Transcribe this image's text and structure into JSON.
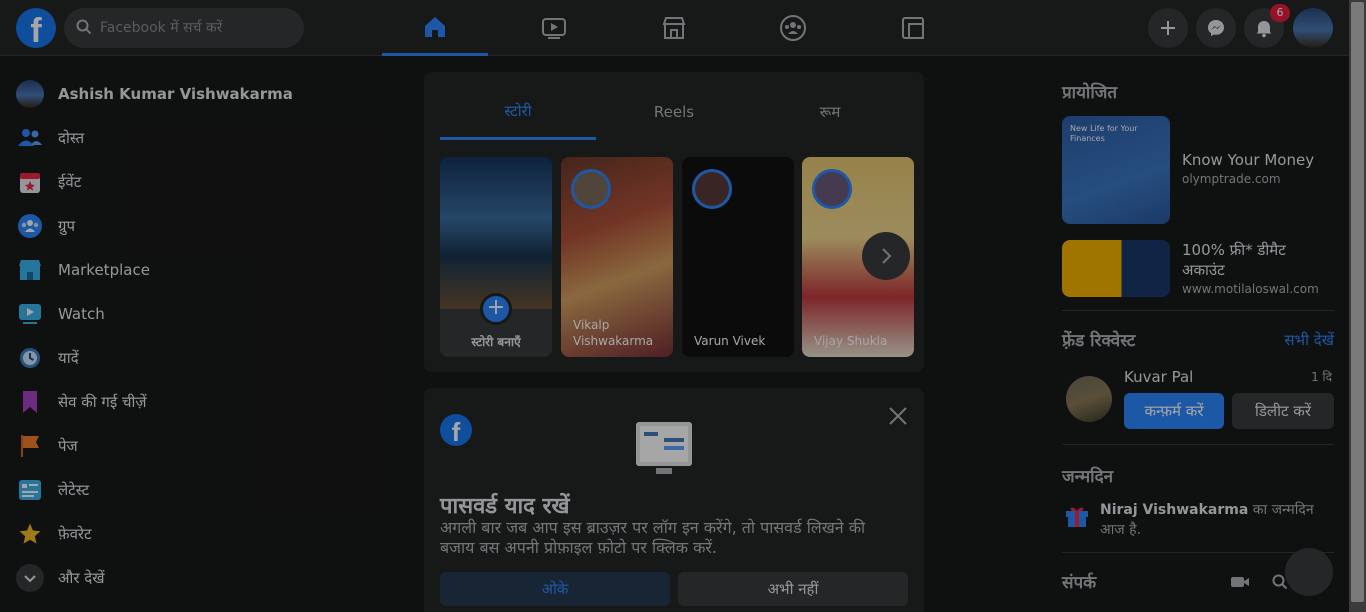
{
  "header": {
    "logo": "f",
    "search_placeholder": "Facebook में सर्च करें",
    "nav_tabs": [
      "home-icon",
      "watch-icon",
      "marketplace-icon",
      "groups-icon",
      "gaming-icon"
    ],
    "notification_count": "6"
  },
  "left_nav": {
    "items": [
      {
        "label": "Ashish Kumar Vishwakarma",
        "icon": "profile-avatar"
      },
      {
        "label": "दोस्त",
        "icon": "friends-icon"
      },
      {
        "label": "ईवेंट",
        "icon": "events-icon"
      },
      {
        "label": "ग्रुप",
        "icon": "groups-icon"
      },
      {
        "label": "Marketplace",
        "icon": "marketplace-icon"
      },
      {
        "label": "Watch",
        "icon": "watch-icon"
      },
      {
        "label": "यादें",
        "icon": "memories-icon"
      },
      {
        "label": "सेव की गई चीज़ें",
        "icon": "saved-icon"
      },
      {
        "label": "पेज",
        "icon": "pages-icon"
      },
      {
        "label": "लेटेस्ट",
        "icon": "latest-icon"
      },
      {
        "label": "फ़ेवरेट",
        "icon": "favorites-icon"
      },
      {
        "label": "और देखें",
        "icon": "chevron-down-icon"
      }
    ]
  },
  "stories": {
    "tabs": [
      "स्टोरी",
      "Reels",
      "रूम"
    ],
    "create_label": "स्टोरी बनाएँ",
    "items": [
      {
        "name": "Vikalp Vishwakarma"
      },
      {
        "name": "Varun Vivek"
      },
      {
        "name": "Vijay Shukla"
      }
    ]
  },
  "password_card": {
    "title": "पासवर्ड याद रखें",
    "description": "अगली बार जब आप इस ब्राउज़र पर लॉग इन करेंगे, तो पासवर्ड लिखने की बजाय बस अपनी प्रोफ़ाइल फ़ोटो पर क्लिक करें.",
    "ok_label": "ओके",
    "not_now_label": "अभी नहीं"
  },
  "right_rail": {
    "sponsored_heading": "प्रायोजित",
    "ads": [
      {
        "title": "Know Your Money",
        "url": "olymptrade.com"
      },
      {
        "title": "100% फ्री* डीमैट अकाउंट",
        "url": "www.motilaloswal.com"
      }
    ],
    "ad1_image_text": "New Life for Your Finances",
    "friend_requests_heading": "फ़्रेंड रिक्वेस्ट",
    "see_all": "सभी देखें",
    "request": {
      "name": "Kuvar Pal",
      "time": "1 दि",
      "confirm": "कन्फ़र्म करें",
      "delete": "डिलीट करें"
    },
    "birthdays_heading": "जन्मदिन",
    "birthday_name": "Niraj Vishwakarma",
    "birthday_text": " का जन्मदिन आज है.",
    "contacts_heading": "संपर्क"
  },
  "colors": {
    "accent": "#2d88ff",
    "brand": "#1877f2",
    "badge": "#e41e3f"
  }
}
